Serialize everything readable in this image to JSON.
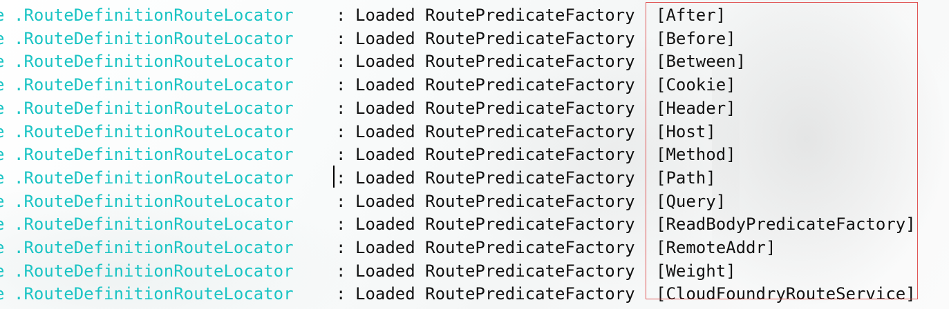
{
  "console": {
    "logger_prefix": "e",
    "separator": ":",
    "lines": [
      {
        "logger": ".RouteDefinitionRouteLocator",
        "message": "Loaded RoutePredicateFactory",
        "predicate": "[After]"
      },
      {
        "logger": ".RouteDefinitionRouteLocator",
        "message": "Loaded RoutePredicateFactory",
        "predicate": "[Before]"
      },
      {
        "logger": ".RouteDefinitionRouteLocator",
        "message": "Loaded RoutePredicateFactory",
        "predicate": "[Between]"
      },
      {
        "logger": ".RouteDefinitionRouteLocator",
        "message": "Loaded RoutePredicateFactory",
        "predicate": "[Cookie]"
      },
      {
        "logger": ".RouteDefinitionRouteLocator",
        "message": "Loaded RoutePredicateFactory",
        "predicate": "[Header]"
      },
      {
        "logger": ".RouteDefinitionRouteLocator",
        "message": "Loaded RoutePredicateFactory",
        "predicate": "[Host]"
      },
      {
        "logger": ".RouteDefinitionRouteLocator",
        "message": "Loaded RoutePredicateFactory",
        "predicate": "[Method]"
      },
      {
        "logger": ".RouteDefinitionRouteLocator",
        "message": "Loaded RoutePredicateFactory",
        "predicate": "[Path]"
      },
      {
        "logger": ".RouteDefinitionRouteLocator",
        "message": "Loaded RoutePredicateFactory",
        "predicate": "[Query]"
      },
      {
        "logger": ".RouteDefinitionRouteLocator",
        "message": "Loaded RoutePredicateFactory",
        "predicate": "[ReadBodyPredicateFactory]"
      },
      {
        "logger": ".RouteDefinitionRouteLocator",
        "message": "Loaded RoutePredicateFactory",
        "predicate": "[RemoteAddr]"
      },
      {
        "logger": ".RouteDefinitionRouteLocator",
        "message": "Loaded RoutePredicateFactory",
        "predicate": "[Weight]"
      },
      {
        "logger": ".RouteDefinitionRouteLocator",
        "message": "Loaded RoutePredicateFactory",
        "predicate": "[CloudFoundryRouteService]"
      }
    ]
  },
  "colors": {
    "logger_text": "#1bc4c4",
    "message_text": "#111111",
    "highlight_border": "#e05555",
    "background": "#ffffff"
  }
}
